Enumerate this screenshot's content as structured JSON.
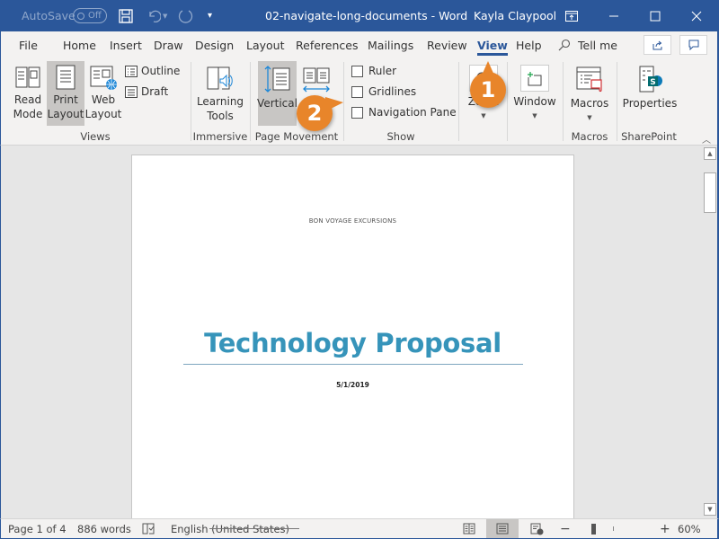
{
  "titlebar": {
    "autosave_label": "AutoSave",
    "autosave_state": "Off",
    "document_title": "02-navigate-long-documents - Word",
    "user_name": "Kayla Claypool"
  },
  "tabs": [
    {
      "label": "File"
    },
    {
      "label": "Home"
    },
    {
      "label": "Insert"
    },
    {
      "label": "Draw"
    },
    {
      "label": "Design"
    },
    {
      "label": "Layout"
    },
    {
      "label": "References"
    },
    {
      "label": "Mailings"
    },
    {
      "label": "Review"
    },
    {
      "label": "View",
      "active": true
    },
    {
      "label": "Help"
    }
  ],
  "tell_me": "Tell me",
  "ribbon": {
    "views": {
      "label": "Views",
      "read_mode": "Read Mode",
      "read_mode_l1": "Read",
      "read_mode_l2": "Mode",
      "print_l1": "Print",
      "print_l2": "Layout",
      "web_l1": "Web",
      "web_l2": "Layout",
      "outline": "Outline",
      "draft": "Draft",
      "selected": "Print Layout"
    },
    "immersive": {
      "label": "Immersive",
      "learning_l1": "Learning",
      "learning_l2": "Tools"
    },
    "page_movement": {
      "label": "Page Movement",
      "vertical": "Vertical",
      "side_to_side": ""
    },
    "show": {
      "label": "Show",
      "ruler": "Ruler",
      "ruler_checked": false,
      "gridlines": "Gridlines",
      "gridlines_checked": false,
      "navigation_pane": "Navigation Pane",
      "navigation_pane_checked": false
    },
    "zoom": {
      "label": "Zoom"
    },
    "window": {
      "label": "Window"
    },
    "macros": {
      "label": "Macros",
      "button": "Macros"
    },
    "sharepoint": {
      "label": "SharePoint",
      "properties": "Properties"
    }
  },
  "document": {
    "header": "BON VOYAGE EXCURSIONS",
    "title": "Technology Proposal",
    "date": "5/1/2019",
    "title_color": "#3694ba"
  },
  "statusbar": {
    "page": "Page 1 of 4",
    "words": "886 words",
    "language": "English (United States)",
    "zoom_percent": "60%",
    "zoom_value": 60
  },
  "callouts": [
    {
      "number": "1",
      "target": "View tab"
    },
    {
      "number": "2",
      "target": "Navigation Pane checkbox"
    }
  ],
  "colors": {
    "brand": "#2b579a",
    "callout": "#e8852a"
  }
}
